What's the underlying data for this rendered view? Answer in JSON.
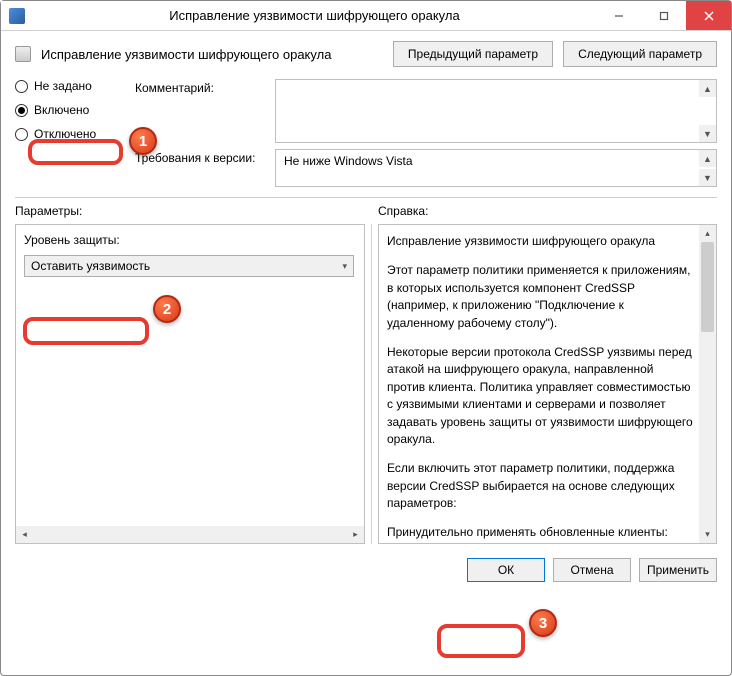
{
  "window": {
    "title": "Исправление уязвимости шифрующего оракула"
  },
  "header": {
    "policy_name": "Исправление уязвимости шифрующего оракула",
    "prev_btn": "Предыдущий параметр",
    "next_btn": "Следующий параметр"
  },
  "radios": {
    "not_configured": "Не задано",
    "enabled": "Включено",
    "disabled": "Отключено",
    "selected": "enabled"
  },
  "labels": {
    "comment": "Комментарий:",
    "requirements": "Требования к версии:"
  },
  "requirements_value": "Не ниже Windows Vista",
  "options": {
    "header": "Параметры:",
    "protection_level_label": "Уровень защиты:",
    "protection_level_value": "Оставить уязвимость"
  },
  "help": {
    "header": "Справка:",
    "p1": "Исправление уязвимости шифрующего оракула",
    "p2": "Этот параметр политики применяется к приложениям, в которых используется компонент CredSSP (например, к приложению \"Подключение к удаленному рабочему столу\").",
    "p3": "Некоторые версии протокола CredSSP уязвимы перед атакой на шифрующего оракула, направленной против клиента. Политика управляет совместимостью с уязвимыми клиентами и серверами и позволяет задавать уровень защиты от уязвимости шифрующего оракула.",
    "p4": "Если включить этот параметр политики, поддержка версии CredSSP выбирается на основе следующих параметров:",
    "p5": "Принудительно применять обновленные клиенты: клиентские приложения, в которых используется"
  },
  "buttons": {
    "ok": "ОК",
    "cancel": "Отмена",
    "apply": "Применить"
  },
  "markers": {
    "m1": "1",
    "m2": "2",
    "m3": "3"
  }
}
